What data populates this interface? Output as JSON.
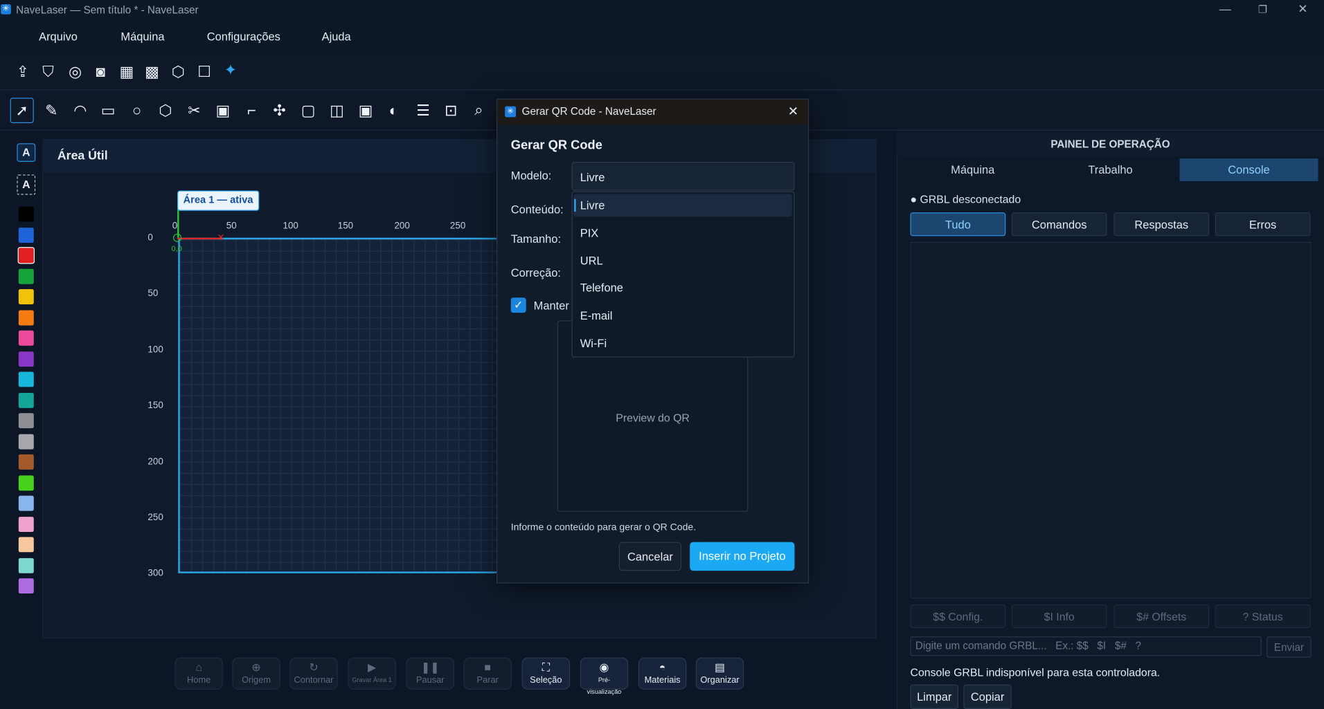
{
  "window": {
    "title": "NaveLaser — Sem título * - NaveLaser",
    "minimize": "—",
    "maximize": "❐",
    "close": "✕"
  },
  "menu": [
    "Arquivo",
    "Máquina",
    "Configurações",
    "Ajuda"
  ],
  "canvas": {
    "title": "Área Útil",
    "area_badge": "Área 1 — ativa",
    "x_ticks": [
      "0",
      "50",
      "100",
      "150",
      "200",
      "250"
    ],
    "y_ticks": [
      "0",
      "50",
      "100",
      "150",
      "200",
      "250",
      "300"
    ],
    "origin_label": "0,0"
  },
  "palette": {
    "text_tool_a": "A",
    "text_tool_b": "A",
    "colors": [
      "#000000",
      "#1e63d8",
      "#e02020",
      "#16a33a",
      "#f2c10a",
      "#f47c12",
      "#ea4b9a",
      "#8a37c8",
      "#17b7dc",
      "#13a59a",
      "#8d8f93",
      "#a6a8ab",
      "#a45a28",
      "#49d21c",
      "#8ab4ec",
      "#efa1cf",
      "#f8c7a0",
      "#7fd7d2",
      "#ae6ce3"
    ]
  },
  "bottom_bar": [
    {
      "label": "Home",
      "icon": "home-icon"
    },
    {
      "label": "Origem",
      "icon": "crosshair-icon"
    },
    {
      "label": "Contornar",
      "icon": "refresh-icon"
    },
    {
      "label": "Gravar Área 1",
      "icon": "play-icon"
    },
    {
      "label": "Pausar",
      "icon": "pause-icon"
    },
    {
      "label": "Parar",
      "icon": "stop-icon"
    },
    {
      "label": "Seleção",
      "icon": "selection-icon"
    },
    {
      "label": "Pré-visualização",
      "icon": "eye-icon"
    },
    {
      "label": "Materiais",
      "icon": "materials-icon"
    },
    {
      "label": "Organizar",
      "icon": "organize-icon"
    }
  ],
  "right_panel": {
    "title": "PAINEL DE OPERAÇÃO",
    "tabs": [
      "Máquina",
      "Trabalho",
      "Console"
    ],
    "active_tab": "Console",
    "status": "● GRBL desconectado",
    "filters": [
      "Tudo",
      "Comandos",
      "Respostas",
      "Erros"
    ],
    "commands": [
      "$$ Config.",
      "$I Info",
      "$# Offsets",
      "? Status"
    ],
    "command_placeholder": "Digite um comando GRBL...   Ex.: $$   $I   $#   ?",
    "send": "Enviar",
    "note": "Console GRBL indisponível para esta controladora.",
    "clear": "Limpar",
    "copy": "Copiar"
  },
  "dialog": {
    "title": "Gerar QR Code - NaveLaser",
    "heading": "Gerar QR Code",
    "model_label": "Modelo:",
    "model_value": "Livre",
    "content_label": "Conteúdo:",
    "size_label": "Tamanho:",
    "correction_label": "Correção:",
    "keep_label": "Manter",
    "keep_checked": true,
    "preview": "Preview do QR",
    "hint": "Informe o conteúdo para gerar o QR Code.",
    "cancel": "Cancelar",
    "insert": "Inserir no Projeto",
    "options": [
      "Livre",
      "PIX",
      "URL",
      "Telefone",
      "E-mail",
      "Wi-Fi"
    ]
  }
}
